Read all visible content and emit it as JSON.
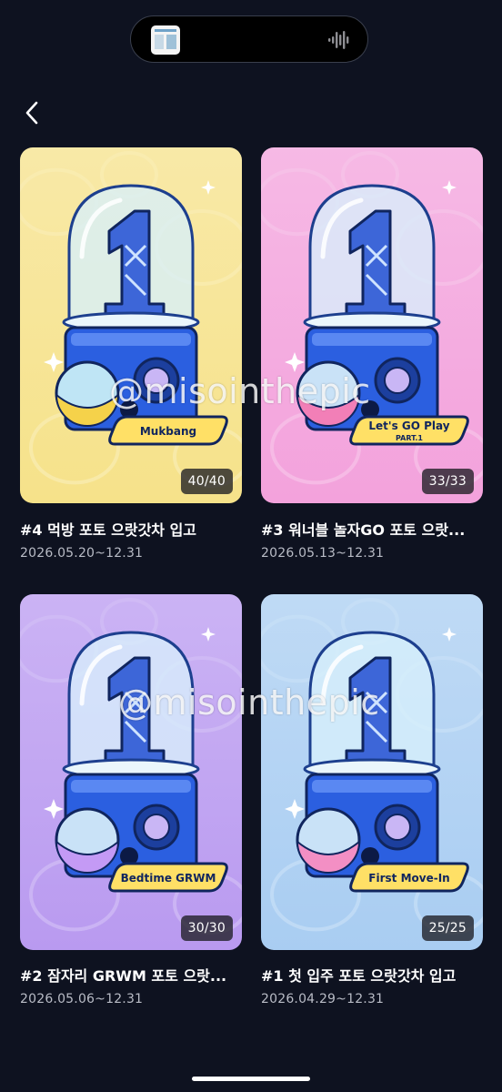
{
  "header": {
    "back_icon": "chevron-left-icon"
  },
  "colors": {
    "background": "#0e1220",
    "badge": "#1e1e24"
  },
  "watermark": "@misointhepic",
  "cards": [
    {
      "title": "#4 먹방 포토 으랏갓차 입고",
      "date": "2026.05.20~12.31",
      "count": "40/40",
      "ribbon": "Mukbang",
      "ribbon_sub": "",
      "bg": "#f6e28a",
      "ball_top": "#bfe5f5",
      "ball_bottom": "#f5d24a"
    },
    {
      "title": "#3 워너블 놀자GO 포토 으랏...",
      "date": "2026.05.13~12.31",
      "count": "33/33",
      "ribbon": "Let's GO Play",
      "ribbon_sub": "PART.1",
      "bg": "#f3a2dc",
      "ball_top": "#c9e2f7",
      "ball_bottom": "#f27fb7"
    },
    {
      "title": "#2 잠자리 GRWM 포토 으랏...",
      "date": "2026.05.06~12.31",
      "count": "30/30",
      "ribbon": "Bedtime GRWM",
      "ribbon_sub": "",
      "bg": "#b99af0",
      "ball_top": "#c9e2f7",
      "ball_bottom": "#c49af5"
    },
    {
      "title": "#1 첫 입주 포토 으랏갓차 입고",
      "date": "2026.04.29~12.31",
      "count": "25/25",
      "ribbon": "First Move-In",
      "ribbon_sub": "",
      "bg": "#a9cdf2",
      "ball_top": "#c9e2f7",
      "ball_bottom": "#f38fc4"
    }
  ]
}
